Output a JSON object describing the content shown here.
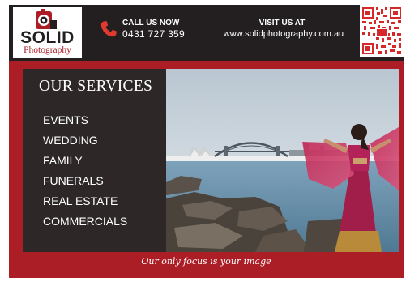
{
  "brand": {
    "name": "SOLID",
    "subtitle": "Photography",
    "logo_icon": "camera-pin-logo"
  },
  "contact": {
    "call_label": "CALL US NOW",
    "phone": "0431 727 359",
    "phone_icon": "phone-icon",
    "visit_label": "VISIT US AT",
    "website": "www.solidphotography.com.au"
  },
  "qr": {
    "icon": "qr-code"
  },
  "services": {
    "title": "OUR SERVICES",
    "items": [
      "EVENTS",
      "WEDDING",
      "FAMILY",
      "FUNERALS",
      "REAL ESTATE",
      "COMMERCIALS"
    ]
  },
  "photo": {
    "subject": "woman in red sari at harbour"
  },
  "tagline": "Our only focus is your image",
  "colors": {
    "brand_red": "#ac1e25",
    "header_dark": "#231f20",
    "panel_dark": "#2d2728"
  }
}
